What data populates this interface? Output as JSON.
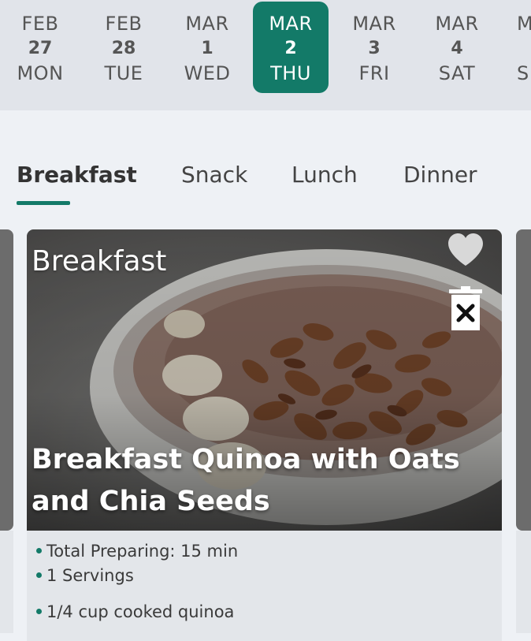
{
  "dates": [
    {
      "month": "FEB",
      "day": "27",
      "weekday": "MON",
      "selected": false
    },
    {
      "month": "FEB",
      "day": "28",
      "weekday": "TUE",
      "selected": false
    },
    {
      "month": "MAR",
      "day": "1",
      "weekday": "WED",
      "selected": false
    },
    {
      "month": "MAR",
      "day": "2",
      "weekday": "THU",
      "selected": true
    },
    {
      "month": "MAR",
      "day": "3",
      "weekday": "FRI",
      "selected": false
    },
    {
      "month": "MAR",
      "day": "4",
      "weekday": "SAT",
      "selected": false
    },
    {
      "month": "M",
      "day": "",
      "weekday": "S",
      "selected": false
    }
  ],
  "tabs": [
    {
      "label": "Breakfast",
      "active": true
    },
    {
      "label": "Snack",
      "active": false
    },
    {
      "label": "Lunch",
      "active": false
    },
    {
      "label": "Dinner",
      "active": false
    }
  ],
  "card": {
    "category": "Breakfast",
    "title": "Breakfast Quinoa with Oats and Chia Seeds",
    "icons": {
      "favorite": "heart-icon",
      "delete": "trash-icon"
    },
    "details": [
      "Total Preparing: 15 min",
      "1 Servings",
      "1/4 cup cooked quinoa"
    ]
  },
  "colors": {
    "accent": "#137a68",
    "background": "#eef1f5",
    "date_strip": "#e1e4ea",
    "card_details": "#e3e6ea"
  }
}
